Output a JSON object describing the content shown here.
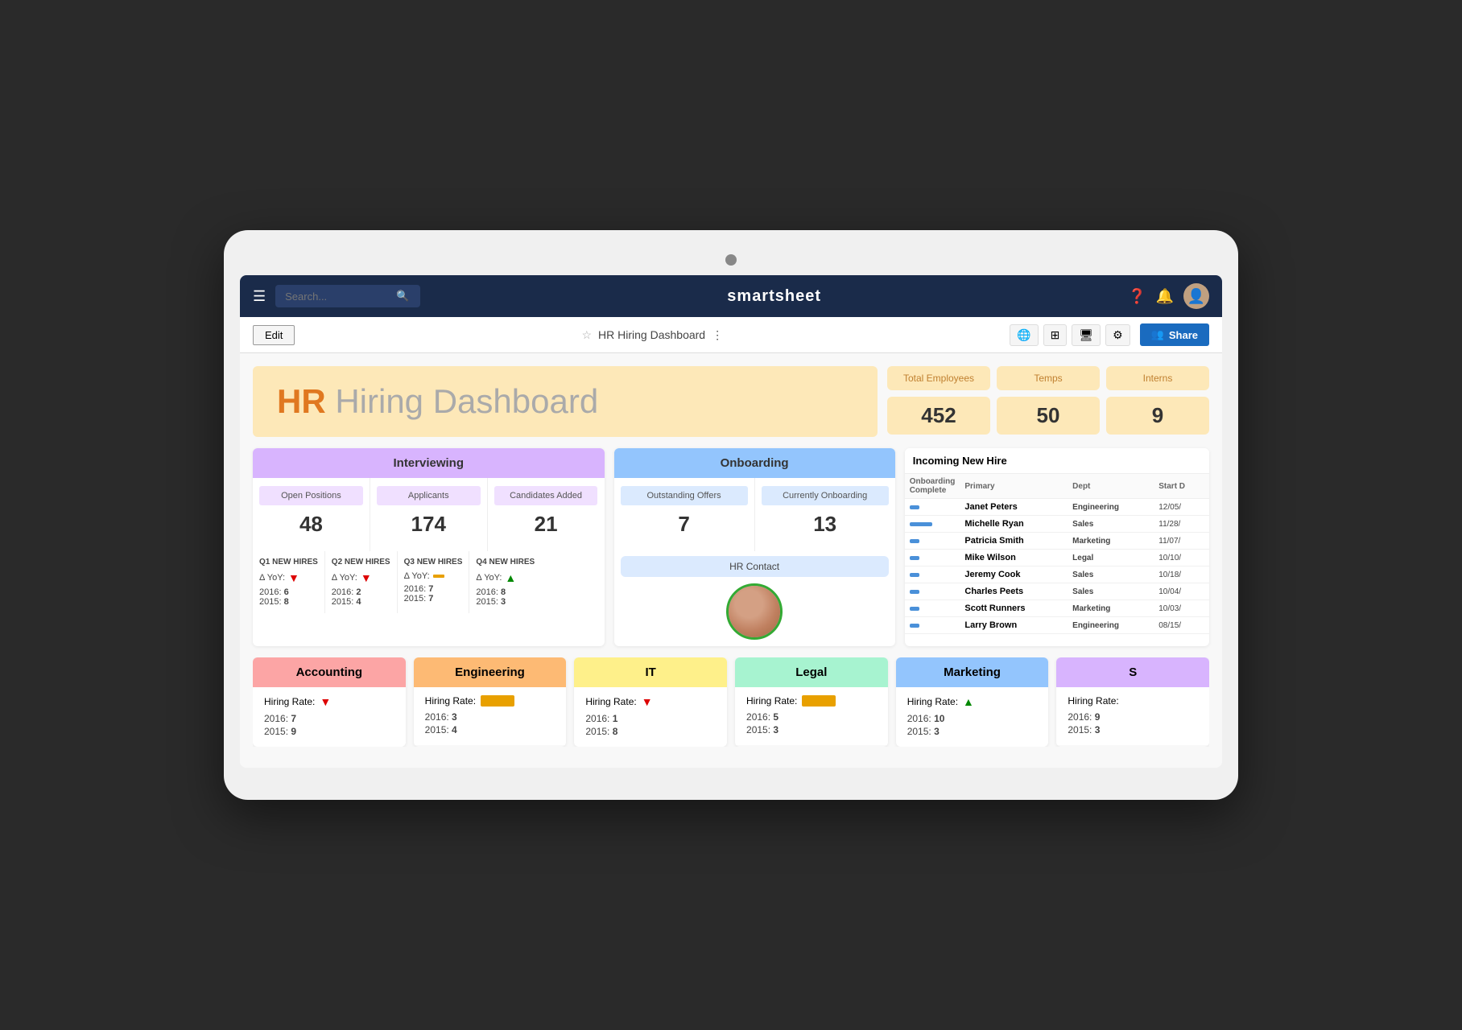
{
  "app": {
    "name": "smartsheet",
    "name_bold": "smart",
    "name_regular": "sheet"
  },
  "nav": {
    "search_placeholder": "Search...",
    "title": "smartsheet"
  },
  "toolbar": {
    "edit_label": "Edit",
    "page_title": "HR Hiring Dashboard",
    "share_label": "Share"
  },
  "header": {
    "title_bold": "HR",
    "title_regular": " Hiring Dashboard",
    "total_employees_label": "Total Employees",
    "total_employees_value": "452",
    "temps_label": "Temps",
    "temps_value": "50",
    "interns_label": "Interns",
    "interns_value": "9"
  },
  "interviewing": {
    "title": "Interviewing",
    "metrics": [
      {
        "label": "Open Positions",
        "value": "48"
      },
      {
        "label": "Applicants",
        "value": "174"
      },
      {
        "label": "Candidates Added",
        "value": "21"
      }
    ],
    "quarters": [
      {
        "label": "Q1 NEW HIRES",
        "yoy": "▼",
        "yoy_type": "down",
        "y2016": "6",
        "y2015": "8"
      },
      {
        "label": "Q2 NEW HIRES",
        "yoy": "▼",
        "yoy_type": "down",
        "y2016": "2",
        "y2015": "4"
      },
      {
        "label": "Q3 NEW HIRES",
        "yoy": "flat",
        "yoy_type": "flat",
        "y2016": "7",
        "y2015": "7"
      },
      {
        "label": "Q4 NEW HIRES",
        "yoy": "▲",
        "yoy_type": "up",
        "y2016": "8",
        "y2015": "3"
      }
    ]
  },
  "onboarding": {
    "title": "Onboarding",
    "metrics": [
      {
        "label": "Outstanding Offers",
        "value": "7"
      },
      {
        "label": "Currently Onboarding",
        "value": "13"
      }
    ],
    "hr_contact_label": "HR Contact"
  },
  "newhire": {
    "title": "Incoming New Hire",
    "columns": [
      "Onboarding Complete",
      "Primary",
      "Dept",
      "Start D"
    ],
    "rows": [
      {
        "progress": "sm",
        "name": "Janet Peters",
        "dept": "Engineering",
        "date": "12/05/"
      },
      {
        "progress": "md",
        "name": "Michelle Ryan",
        "dept": "Sales",
        "date": "11/28/"
      },
      {
        "progress": "sm",
        "name": "Patricia Smith",
        "dept": "Marketing",
        "date": "11/07/"
      },
      {
        "progress": "sm",
        "name": "Mike Wilson",
        "dept": "Legal",
        "date": "10/10/"
      },
      {
        "progress": "sm",
        "name": "Jeremy Cook",
        "dept": "Sales",
        "date": "10/18/"
      },
      {
        "progress": "sm",
        "name": "Charles Peets",
        "dept": "Sales",
        "date": "10/04/"
      },
      {
        "progress": "sm",
        "name": "Scott Runners",
        "dept": "Marketing",
        "date": "10/03/"
      },
      {
        "progress": "sm",
        "name": "Larry Brown",
        "dept": "Engineering",
        "date": "08/15/"
      }
    ]
  },
  "departments": [
    {
      "name": "Accounting",
      "color_class": "pink",
      "hiring_rate_type": "down",
      "y2016": "7",
      "y2015": "9"
    },
    {
      "name": "Engineering",
      "color_class": "orange",
      "hiring_rate_type": "bar",
      "y2016": "3",
      "y2015": "4"
    },
    {
      "name": "IT",
      "color_class": "yellow",
      "hiring_rate_type": "down",
      "y2016": "1",
      "y2015": "8"
    },
    {
      "name": "Legal",
      "color_class": "green",
      "hiring_rate_type": "bar",
      "y2016": "5",
      "y2015": "3"
    },
    {
      "name": "Marketing",
      "color_class": "blue-dept",
      "hiring_rate_type": "up",
      "y2016": "10",
      "y2015": "3"
    },
    {
      "name": "S",
      "color_class": "purple-dept",
      "hiring_rate_type": "up",
      "y2016": "9",
      "y2015": "3"
    }
  ]
}
